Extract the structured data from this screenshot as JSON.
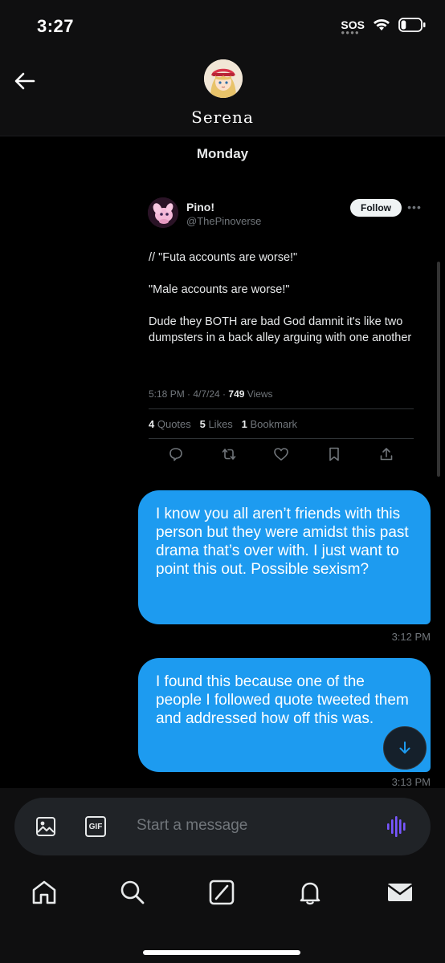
{
  "status": {
    "time": "3:27",
    "sos": "SOS",
    "battery_level": 0.25
  },
  "header": {
    "name": "Serena"
  },
  "conversation": {
    "day_label": "Monday",
    "tweet": {
      "author_name": "Pino!",
      "handle": "@ThePinoverse",
      "follow_label": "Follow",
      "more_icon": "more-dots-icon",
      "text": "// \"Futa accounts are worse!\"\n\n\"Male accounts are worse!\"\n\nDude they BOTH are bad God damnit it's like two dumpsters in a back alley arguing with one another",
      "meta_time": "5:18 PM · 4/7/24 · ",
      "views_count": "749",
      "views_label": " Views",
      "quotes_count": "4",
      "quotes_label": " Quotes",
      "likes_count": "5",
      "likes_label": " Likes",
      "bookmarks_count": "1",
      "bookmarks_label": " Bookmark",
      "actions": [
        "reply-icon",
        "retweet-icon",
        "like-icon",
        "bookmark-icon",
        "share-icon"
      ]
    },
    "messages": [
      {
        "text": "I know you all aren’t friends with this person but they were amidst this past drama that’s over with. I just want to point this out. Possible sexism?",
        "time": "3:12 PM"
      },
      {
        "text": "I found this because one of the people I followed quote tweeted them and addressed how off this was.",
        "time": "3:13 PM"
      }
    ]
  },
  "composer": {
    "placeholder": "Start a message",
    "gif_label": "GIF"
  },
  "tabs": [
    "home-icon",
    "search-icon",
    "grok-icon",
    "notifications-icon",
    "messages-icon"
  ],
  "colors": {
    "accent": "#1d9bf0",
    "background": "#000000",
    "voice": "#7856ff"
  }
}
